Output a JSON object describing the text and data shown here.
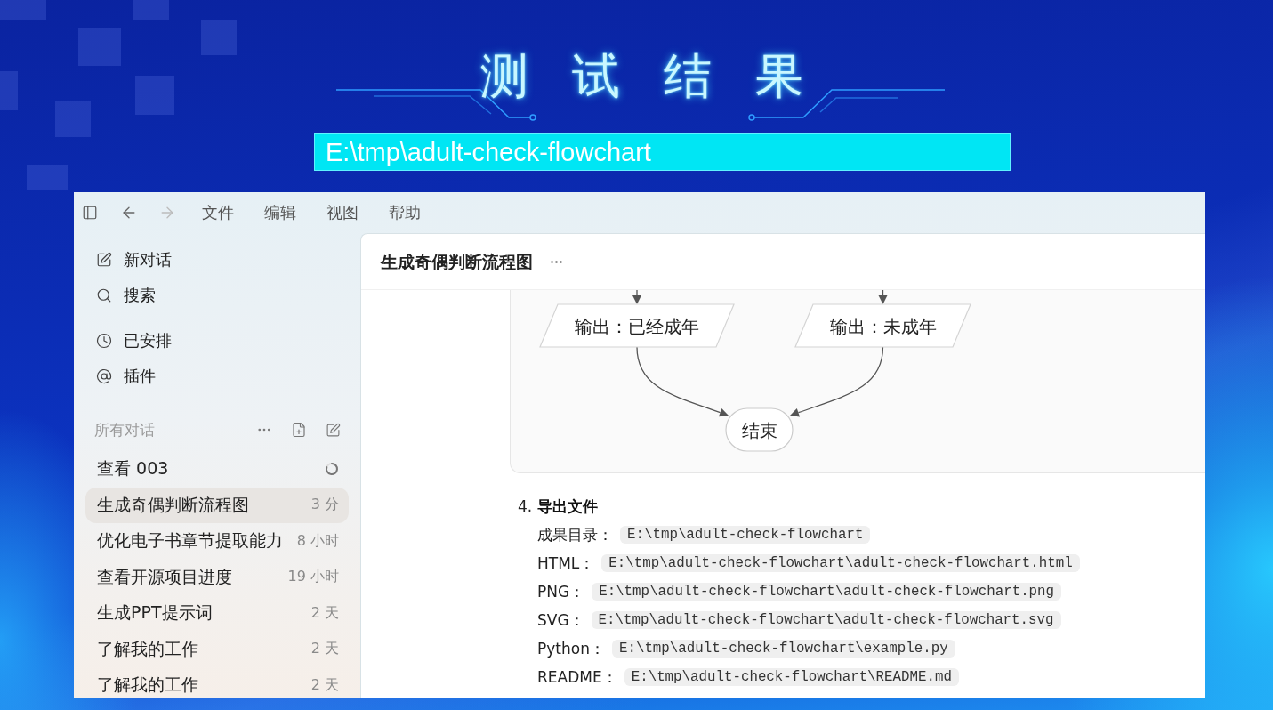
{
  "slide": {
    "title": "测 试 结 果",
    "banner": "E:\\tmp\\adult-check-flowchart"
  },
  "toolbar": {
    "nav": [
      {
        "kind": "back",
        "disabled": false
      },
      {
        "kind": "forward",
        "disabled": true
      }
    ],
    "menu": [
      "文件",
      "编辑",
      "视图",
      "帮助"
    ]
  },
  "sidebar": {
    "action_groups": [
      [
        {
          "kind": "new",
          "label": "新对话"
        },
        {
          "kind": "search",
          "label": "搜索"
        }
      ],
      [
        {
          "kind": "scheduled",
          "label": "已安排"
        },
        {
          "kind": "plugins",
          "label": "插件"
        }
      ]
    ],
    "section": {
      "title": "所有对话"
    },
    "conversations": [
      {
        "title": "查看 003",
        "busy": true,
        "selected": false
      },
      {
        "title": "生成奇偶判断流程图",
        "time": "3 分",
        "busy": false,
        "selected": true
      },
      {
        "title": "优化电子书章节提取能力",
        "time": "8 小时",
        "busy": false,
        "selected": false
      },
      {
        "title": "查看开源项目进度",
        "time": "19 小时",
        "busy": false,
        "selected": false
      },
      {
        "title": "生成PPT提示词",
        "time": "2 天",
        "busy": false,
        "selected": false
      },
      {
        "title": "了解我的工作",
        "time": "2 天",
        "busy": false,
        "selected": false
      },
      {
        "title": "了解我的工作",
        "time": "2 天",
        "busy": false,
        "selected": false
      }
    ]
  },
  "chat": {
    "title": "生成奇偶判断流程图",
    "flowchart": {
      "nodes": [
        {
          "kind": "output",
          "label": "输出：已经成年"
        },
        {
          "kind": "output",
          "label": "输出：未成年"
        },
        {
          "kind": "end",
          "label": "结束"
        }
      ]
    },
    "steps": [
      {
        "number": "4.",
        "title": "导出文件",
        "files": [
          {
            "label": "成果目录：",
            "path": "E:\\tmp\\adult-check-flowchart"
          },
          {
            "label": "HTML：",
            "path": "E:\\tmp\\adult-check-flowchart\\adult-check-flowchart.html"
          },
          {
            "label": "PNG：",
            "path": "E:\\tmp\\adult-check-flowchart\\adult-check-flowchart.png"
          },
          {
            "label": "SVG：",
            "path": "E:\\tmp\\adult-check-flowchart\\adult-check-flowchart.svg"
          },
          {
            "label": "Python：",
            "path": "E:\\tmp\\adult-check-flowchart\\example.py"
          },
          {
            "label": "README：",
            "path": "E:\\tmp\\adult-check-flowchart\\README.md"
          }
        ]
      }
    ]
  }
}
